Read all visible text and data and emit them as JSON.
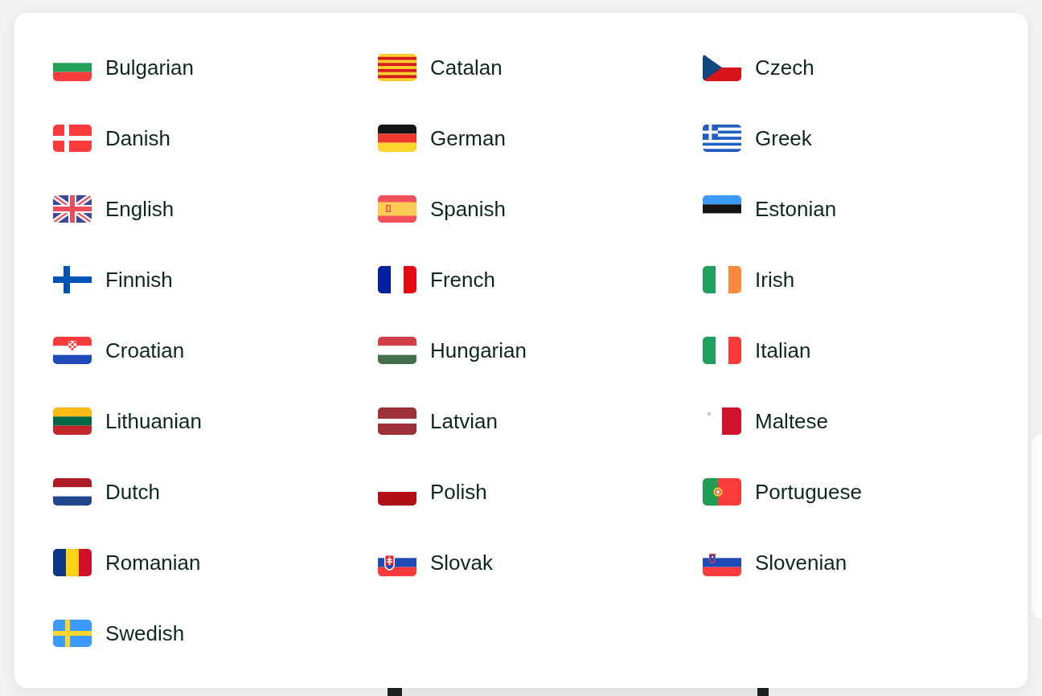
{
  "language_menu": {
    "options": [
      {
        "label": "Bulgarian"
      },
      {
        "label": "Catalan"
      },
      {
        "label": "Czech"
      },
      {
        "label": "Danish"
      },
      {
        "label": "German"
      },
      {
        "label": "Greek"
      },
      {
        "label": "English"
      },
      {
        "label": "Spanish"
      },
      {
        "label": "Estonian"
      },
      {
        "label": "Finnish"
      },
      {
        "label": "French"
      },
      {
        "label": "Irish"
      },
      {
        "label": "Croatian"
      },
      {
        "label": "Hungarian"
      },
      {
        "label": "Italian"
      },
      {
        "label": "Lithuanian"
      },
      {
        "label": "Latvian"
      },
      {
        "label": "Maltese"
      },
      {
        "label": "Dutch"
      },
      {
        "label": "Polish"
      },
      {
        "label": "Portuguese"
      },
      {
        "label": "Romanian"
      },
      {
        "label": "Slovak"
      },
      {
        "label": "Slovenian"
      },
      {
        "label": "Swedish"
      }
    ]
  }
}
